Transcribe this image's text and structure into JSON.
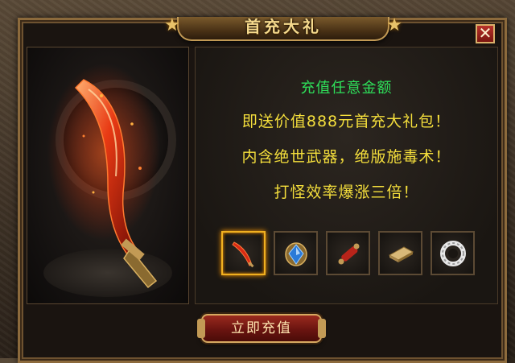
{
  "dialog": {
    "title": "首充大礼",
    "close_label": "✕"
  },
  "promo": {
    "line1": "充值任意金额",
    "line2": "即送价值888元首充大礼包！",
    "line3": "内含绝世武器，绝版施毒术！",
    "line4": "打怪效率爆涨三倍！"
  },
  "rewards": [
    {
      "icon": "blade-icon",
      "selected": true
    },
    {
      "icon": "blue-gem-icon",
      "selected": false
    },
    {
      "icon": "scroll-icon",
      "selected": false
    },
    {
      "icon": "book-icon",
      "selected": false
    },
    {
      "icon": "jade-ring-icon",
      "selected": false
    }
  ],
  "recharge_button": {
    "label": "立即充值"
  },
  "colors": {
    "accent_green": "#2ee05a",
    "accent_yellow": "#f5df3c",
    "frame_gold": "#c29a55",
    "button_red": "#6a1410"
  }
}
